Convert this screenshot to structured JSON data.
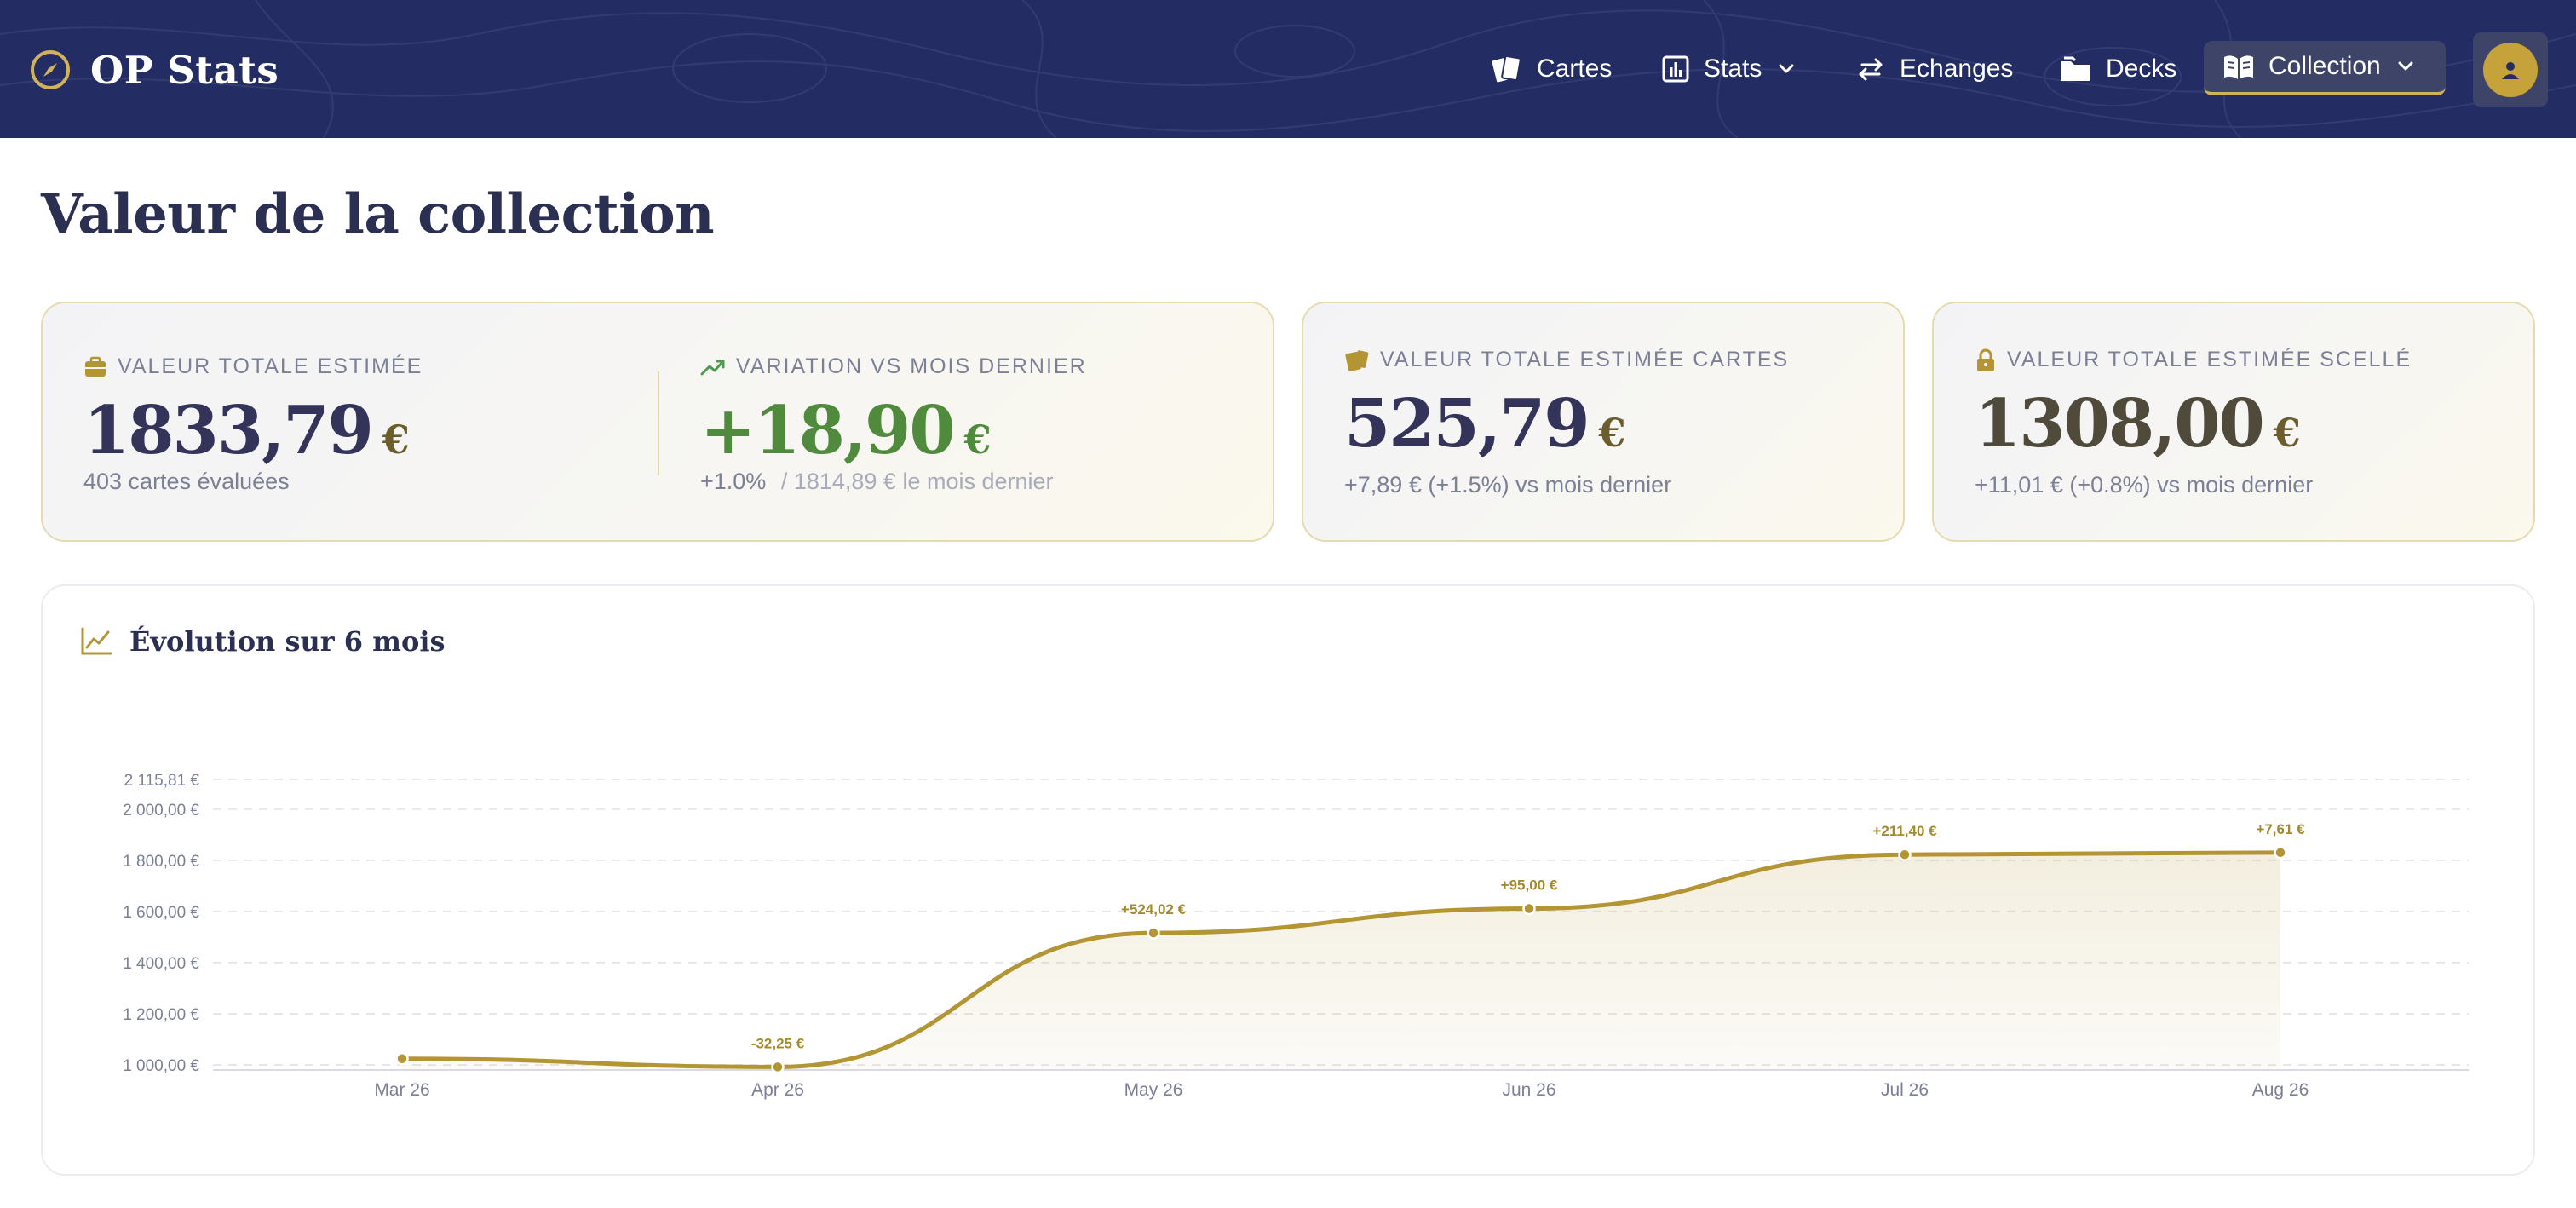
{
  "brand": {
    "title": "OP Stats"
  },
  "nav": {
    "cartes": "Cartes",
    "stats": "Stats",
    "echanges": "Echanges",
    "decks": "Decks",
    "collection": "Collection"
  },
  "page": {
    "title": "Valeur de la collection"
  },
  "total": {
    "label": "VALEUR TOTALE ESTIMÉE",
    "value": "1833,79",
    "currency": "€",
    "sub": "403 cartes évaluées"
  },
  "variation": {
    "label": "VARIATION VS MOIS DERNIER",
    "value": "+18,90",
    "currency": "€",
    "pct": "+1.0%",
    "sub": "/ 1814,89 € le mois dernier"
  },
  "cards_value": {
    "label": "VALEUR TOTALE ESTIMÉE CARTES",
    "value": "525,79",
    "currency": "€",
    "sub": "+7,89 € (+1.5%) vs mois dernier"
  },
  "sealed_value": {
    "label": "VALEUR TOTALE ESTIMÉE SCELLÉ",
    "value": "1308,00",
    "currency": "€",
    "sub": "+11,01 € (+0.8%) vs mois dernier"
  },
  "chart": {
    "title": "Évolution sur 6 mois"
  },
  "colors": {
    "navbar": "#232c63",
    "gold": "#b39534",
    "accent_green": "#4f8a3d",
    "title": "#2b2f52"
  },
  "chart_data": {
    "type": "area",
    "title": "Évolution sur 6 mois",
    "xlabel": "",
    "ylabel": "",
    "categories": [
      "Mar 26",
      "Apr 26",
      "May 26",
      "Jun 26",
      "Jul 26",
      "Aug 26"
    ],
    "values": [
      1024,
      992,
      1516,
      1611,
      1822,
      1830
    ],
    "annotations": [
      "",
      "-32,25 €",
      "+524,02 €",
      "+95,00 €",
      "+211,40 €",
      "+7,61 €"
    ],
    "ylim": [
      1000,
      2115.81
    ],
    "yticks": [
      1000,
      1200,
      1400,
      1600,
      1800,
      2000,
      2115.81
    ],
    "ytick_labels": [
      "1 000,00 €",
      "1 200,00 €",
      "1 400,00 €",
      "1 600,00 €",
      "1 800,00 €",
      "2 000,00 €",
      "2 115,81 €"
    ],
    "grid": true,
    "legend": "none",
    "color": "#b39534"
  }
}
